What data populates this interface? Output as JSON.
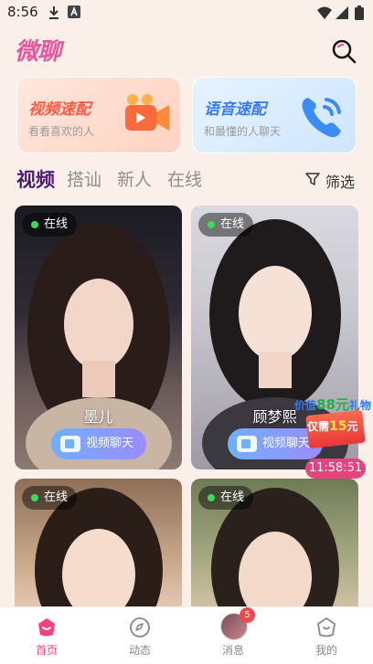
{
  "status_bar": {
    "time": "8:56"
  },
  "header": {
    "logo": "微聊"
  },
  "match_cards": {
    "video": {
      "title": "视频速配",
      "subtitle": "看看喜欢的人"
    },
    "voice": {
      "title": "语音速配",
      "subtitle": "和最懂的人聊天"
    }
  },
  "tabs": [
    {
      "label": "视频"
    },
    {
      "label": "搭讪"
    },
    {
      "label": "新人"
    },
    {
      "label": "在线"
    }
  ],
  "filter": {
    "label": "筛选"
  },
  "cards": [
    {
      "status": "在线",
      "name": "墨儿",
      "button": "视频聊天"
    },
    {
      "status": "在线",
      "name": "顾梦熙",
      "button": "视频聊天"
    },
    {
      "status": "在线"
    },
    {
      "status": "在线"
    }
  ],
  "promo": {
    "line1_prefix": "价值",
    "line1_amount": "88元",
    "line1_suffix": "礼物",
    "line2_prefix": "仅需",
    "line2_amount": "15",
    "line2_suffix": "元"
  },
  "timer": "11:58:51",
  "bottom_nav": [
    {
      "label": "首页"
    },
    {
      "label": "动态"
    },
    {
      "label": "消息",
      "badge": "5"
    },
    {
      "label": "我的"
    }
  ],
  "colors": {
    "accent": "#ff3f7d",
    "tab_active": "#4b1e74",
    "online": "#3ddb5b"
  }
}
